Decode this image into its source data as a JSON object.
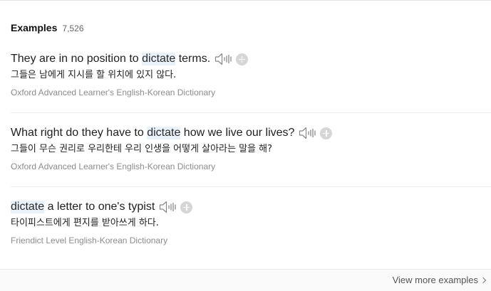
{
  "header": {
    "title": "Examples",
    "count": "7,526"
  },
  "examples": [
    {
      "en_parts": [
        {
          "text": "They are in no position to ",
          "highlight": false
        },
        {
          "text": "dictate",
          "highlight": true
        },
        {
          "text": " terms.",
          "highlight": false
        }
      ],
      "ko": "그들은 남에게 지시를 할 위치에 있지 않다.",
      "source": "Oxford Advanced Learner's English-Korean Dictionary"
    },
    {
      "en_parts": [
        {
          "text": "What right do they have to ",
          "highlight": false
        },
        {
          "text": "dictate",
          "highlight": true
        },
        {
          "text": " how we live our lives?",
          "highlight": false
        }
      ],
      "ko": "그들이 무슨 권리로 우리한테 우리 인생을 어떻게 살아라는 말을 해?",
      "source": "Oxford Advanced Learner's English-Korean Dictionary"
    },
    {
      "en_parts": [
        {
          "text": "dictate",
          "highlight": true
        },
        {
          "text": " a letter to one's typist",
          "highlight": false
        }
      ],
      "ko": "타이피스트에게 편지를 받아쓰게 하다.",
      "source": "Friendict Level English-Korean Dictionary"
    }
  ],
  "footer": {
    "view_more": "View more examples"
  },
  "icons": {
    "speaker": "speaker-icon",
    "add": "add-icon",
    "chevron": "chevron-right-icon"
  },
  "colors": {
    "highlight_bg": "#e9f1fb",
    "source_text": "#8c8c8c",
    "add_icon": "#d6d6d6"
  }
}
